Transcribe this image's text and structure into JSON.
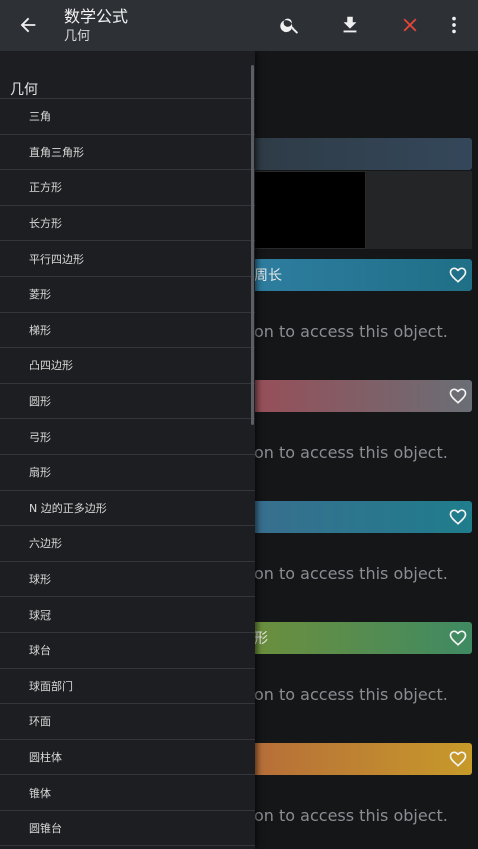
{
  "header": {
    "title": "数学公式",
    "subtitle": "几何",
    "icons": [
      "arrow-back-icon",
      "search-icon",
      "download-icon",
      "close-icon",
      "more-vert-icon"
    ],
    "close_color": "#e8463a"
  },
  "content": {
    "cards": [
      {
        "label": "",
        "gradient": [
          "#2e3b46",
          "#34475a"
        ]
      },
      {
        "label": "周长",
        "gradient": [
          "#2f7ea2",
          "#1f6f87"
        ]
      },
      {
        "label": "",
        "gradient": [
          "#9a4d57",
          "#6a6e75"
        ]
      },
      {
        "label": "",
        "gradient": [
          "#3a6e8f",
          "#1f7d8c"
        ]
      },
      {
        "label": "形",
        "gradient": [
          "#6f8f3a",
          "#3f8a63"
        ]
      },
      {
        "label": "",
        "gradient": [
          "#b56b3a",
          "#c79a2a"
        ]
      }
    ],
    "locked_message": "on to access this object."
  },
  "drawer": {
    "header": "几何",
    "items": [
      "三角",
      "直角三角形",
      "正方形",
      "长方形",
      "平行四边形",
      "菱形",
      "梯形",
      "凸四边形",
      "圆形",
      "弓形",
      "扇形",
      "N 边的正多边形",
      "六边形",
      "球形",
      "球冠",
      "球台",
      "球面部门",
      "环面",
      "圆柱体",
      "锥体",
      "圆锥台"
    ]
  }
}
